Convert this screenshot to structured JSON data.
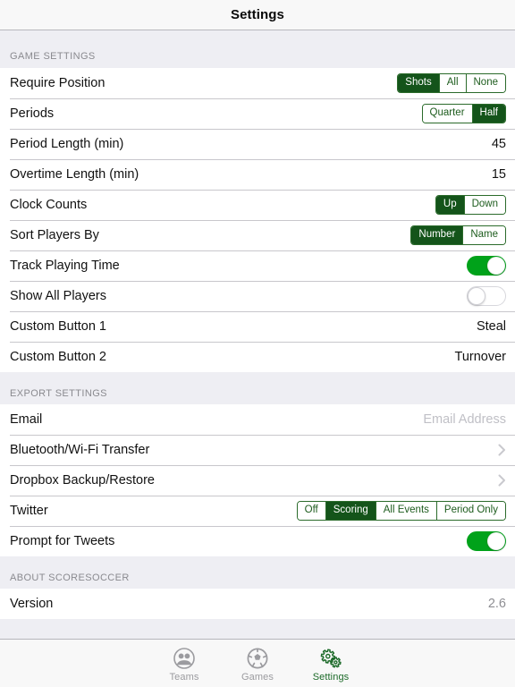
{
  "navbar": {
    "title": "Settings"
  },
  "sections": [
    {
      "id": "game-settings",
      "header": "GAME SETTINGS",
      "rows": [
        {
          "id": "require-position",
          "label": "Require Position",
          "type": "segmented",
          "options": [
            "Shots",
            "All",
            "None"
          ],
          "selected": "Shots"
        },
        {
          "id": "periods",
          "label": "Periods",
          "type": "segmented",
          "options": [
            "Quarter",
            "Half"
          ],
          "selected": "Half"
        },
        {
          "id": "period-length",
          "label": "Period Length (min)",
          "type": "value",
          "value": "45"
        },
        {
          "id": "overtime-length",
          "label": "Overtime Length (min)",
          "type": "value",
          "value": "15"
        },
        {
          "id": "clock-counts",
          "label": "Clock Counts",
          "type": "segmented",
          "options": [
            "Up",
            "Down"
          ],
          "selected": "Up"
        },
        {
          "id": "sort-players-by",
          "label": "Sort Players By",
          "type": "segmented",
          "options": [
            "Number",
            "Name"
          ],
          "selected": "Number"
        },
        {
          "id": "track-playing-time",
          "label": "Track Playing Time",
          "type": "switch",
          "on": true
        },
        {
          "id": "show-all-players",
          "label": "Show All Players",
          "type": "switch",
          "on": false
        },
        {
          "id": "custom-button-1",
          "label": "Custom Button 1",
          "type": "value",
          "value": "Steal"
        },
        {
          "id": "custom-button-2",
          "label": "Custom Button 2",
          "type": "value",
          "value": "Turnover"
        }
      ]
    },
    {
      "id": "export-settings",
      "header": "EXPORT SETTINGS",
      "rows": [
        {
          "id": "email",
          "label": "Email",
          "type": "input",
          "value": "",
          "placeholder": "Email Address"
        },
        {
          "id": "bluetooth-wifi-transfer",
          "label": "Bluetooth/Wi-Fi Transfer",
          "type": "disclosure"
        },
        {
          "id": "dropbox-backup-restore",
          "label": "Dropbox Backup/Restore",
          "type": "disclosure"
        },
        {
          "id": "twitter",
          "label": "Twitter",
          "type": "segmented",
          "options": [
            "Off",
            "Scoring",
            "All Events",
            "Period Only"
          ],
          "selected": "Scoring"
        },
        {
          "id": "prompt-for-tweets",
          "label": "Prompt for Tweets",
          "type": "switch",
          "on": true
        }
      ]
    },
    {
      "id": "about-scoresoccer",
      "header": "ABOUT SCORESOCCER",
      "rows": [
        {
          "id": "version",
          "label": "Version",
          "type": "value",
          "value": "2.6",
          "muted": true
        }
      ]
    }
  ],
  "tabbar": {
    "tabs": [
      {
        "id": "teams",
        "label": "Teams",
        "icon": "people-icon",
        "active": false
      },
      {
        "id": "games",
        "label": "Games",
        "icon": "soccer-ball-icon",
        "active": false
      },
      {
        "id": "settings",
        "label": "Settings",
        "icon": "gears-icon",
        "active": true
      }
    ]
  },
  "colors": {
    "accent_dark_green": "#14541a",
    "segment_border_green": "#2b6b2b",
    "switch_on_green": "#00a21a",
    "active_tab_green": "#1d6b2a",
    "background": "#eeeef3",
    "row_background": "#ffffff",
    "separator": "#c8c7cc",
    "muted_text": "#8e8e93",
    "placeholder_text": "#c0c0c6"
  }
}
